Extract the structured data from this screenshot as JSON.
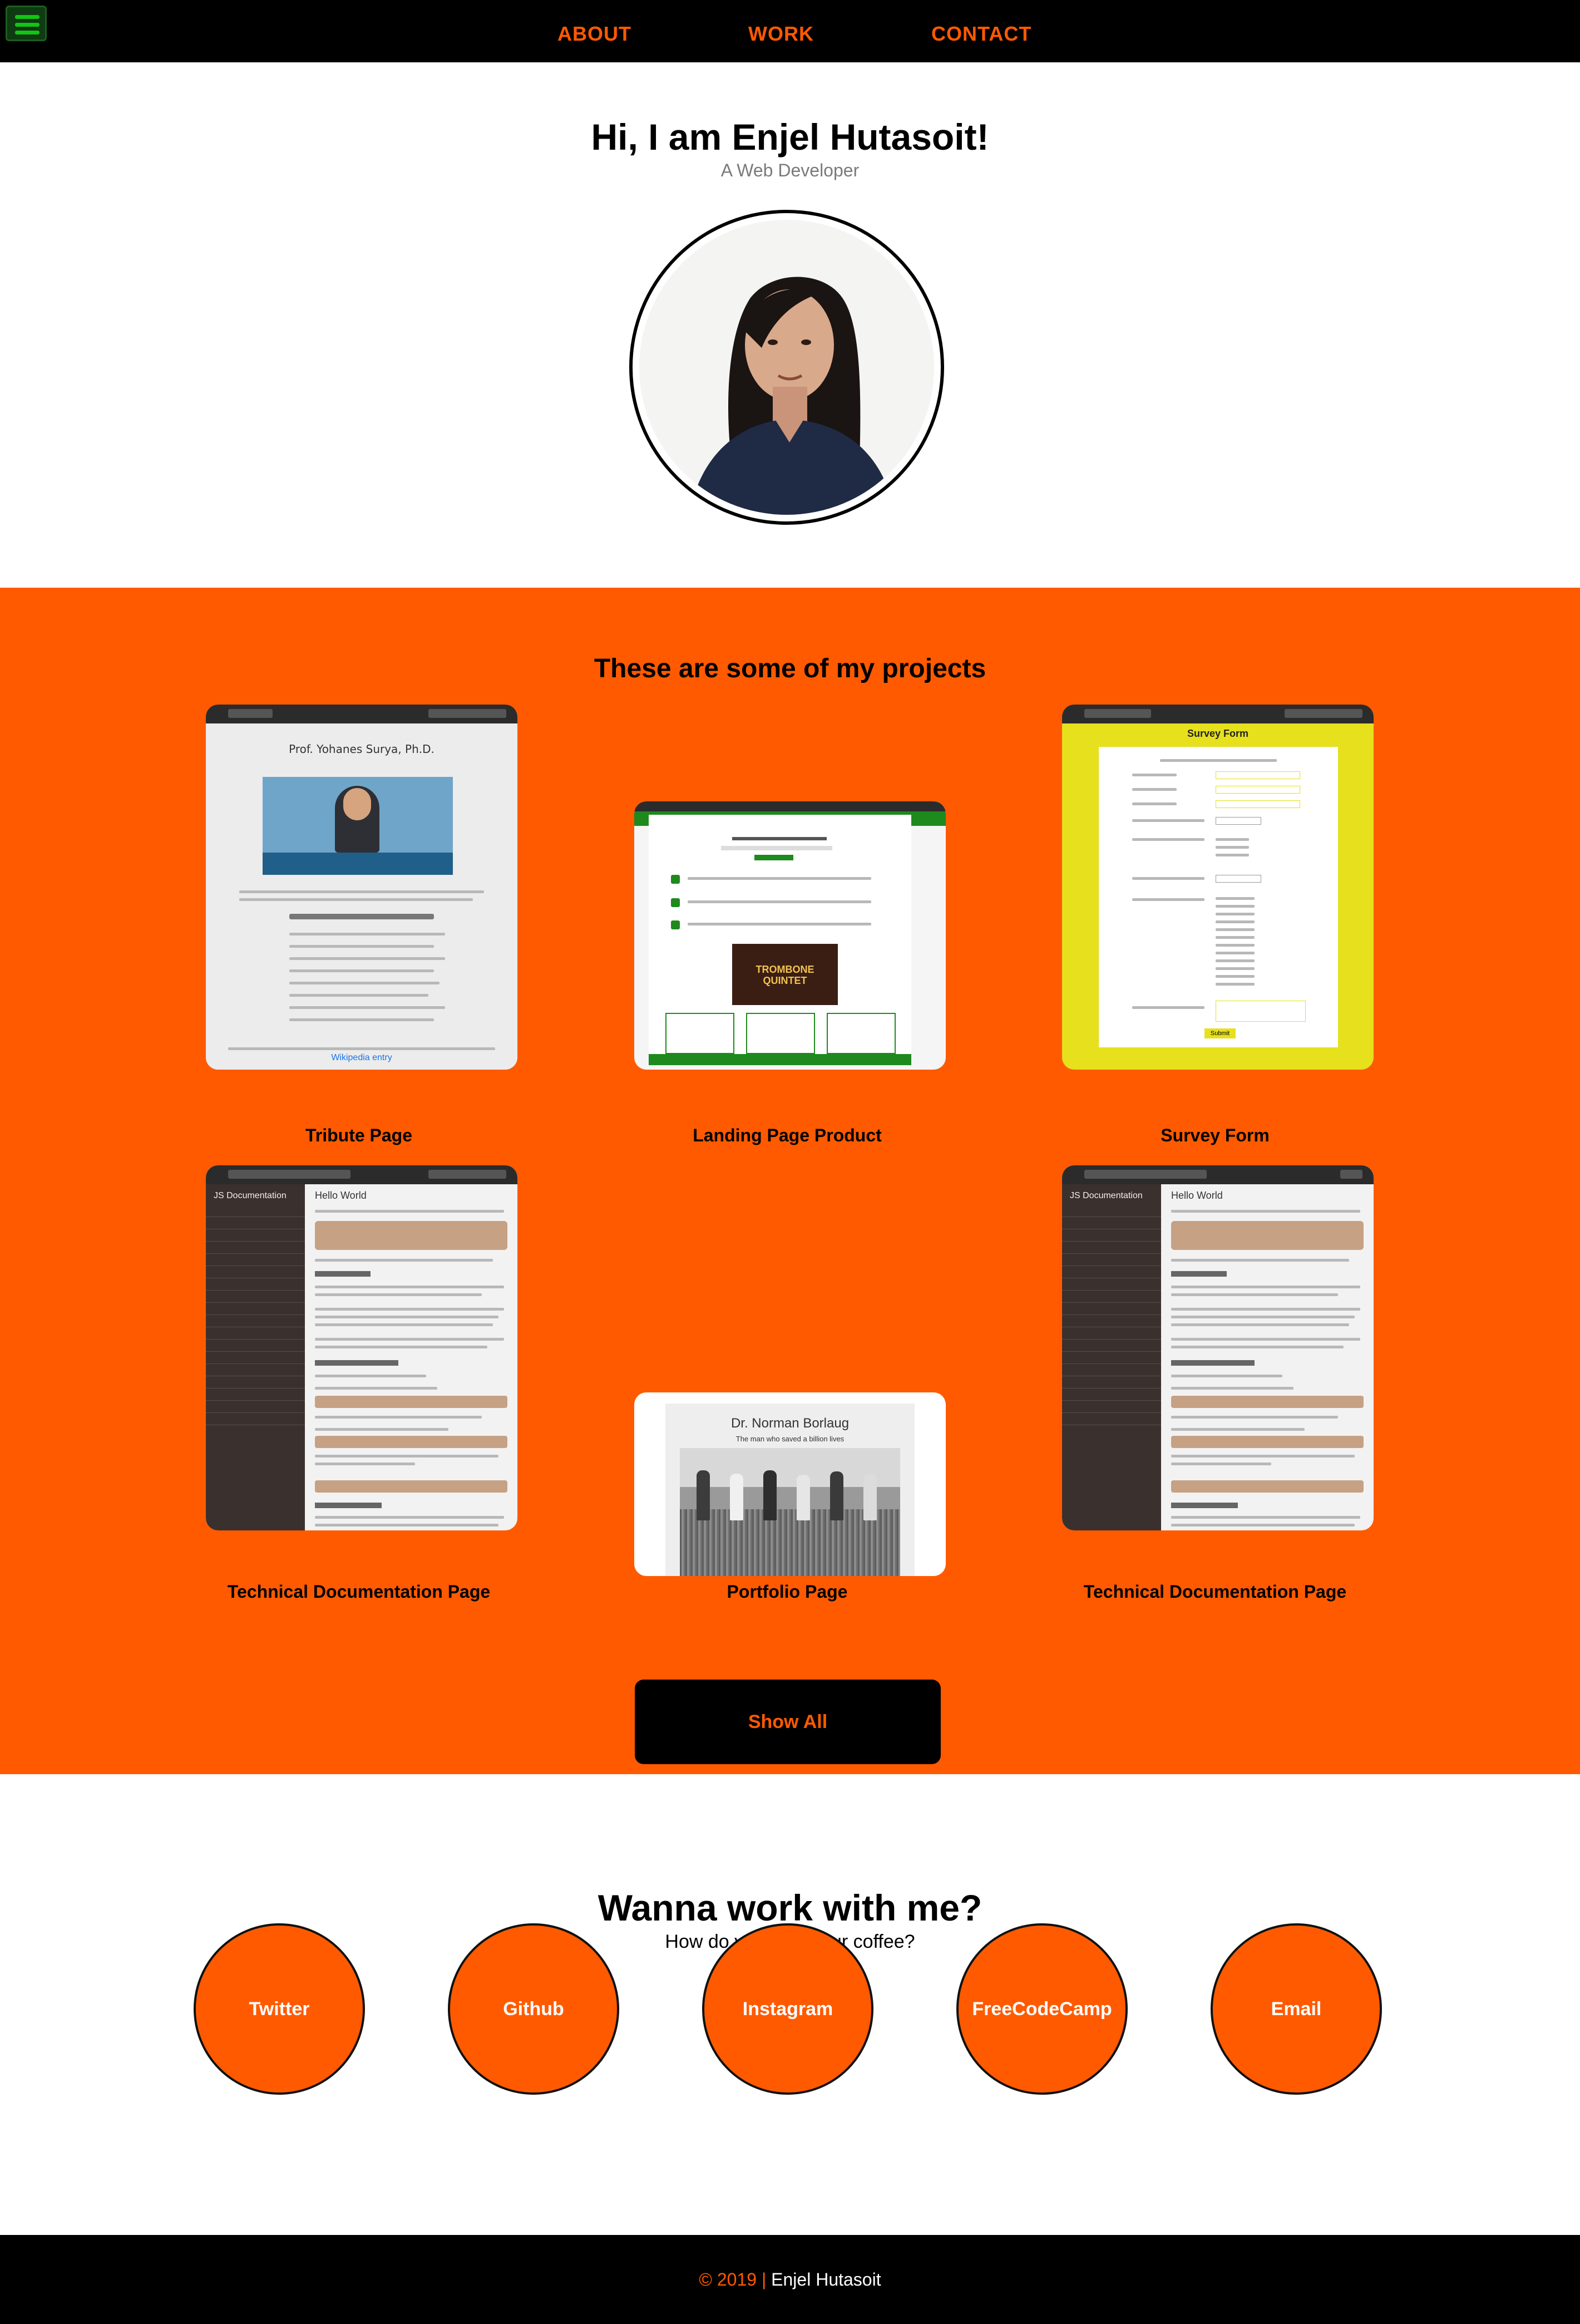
{
  "nav": {
    "links": [
      {
        "label": "ABOUT"
      },
      {
        "label": "WORK"
      },
      {
        "label": "CONTACT"
      }
    ]
  },
  "hero": {
    "title": "Hi, I am Enjel Hutasoit!",
    "subtitle": "A Web Developer"
  },
  "projects": {
    "title": "These are some of my projects",
    "items": [
      {
        "label": "Tribute Page",
        "preview_title": "Prof. Yohanes Surya, Ph.D.",
        "preview_link": "Wikipedia entry"
      },
      {
        "label": "Landing Page Product",
        "preview_title": "TROMBONE QUINTET"
      },
      {
        "label": "Survey Form",
        "preview_title": "Survey Form",
        "preview_button": "Submit"
      },
      {
        "label": "Technical Documentation Page",
        "preview_nav": "JS Documentation",
        "preview_heading": "Hello World"
      },
      {
        "label": "Portfolio Page",
        "preview_title": "Dr. Norman Borlaug",
        "preview_sub": "The man who saved a billion lives"
      },
      {
        "label": "Technical Documentation Page",
        "preview_nav": "JS Documentation",
        "preview_heading": "Hello World"
      }
    ],
    "show_all": "Show All"
  },
  "contact": {
    "title": "Wanna work with me?",
    "subtitle": "How do you take your coffee?",
    "links": [
      {
        "label": "Twitter"
      },
      {
        "label": "Github"
      },
      {
        "label": "Instagram"
      },
      {
        "label": "FreeCodeCamp"
      },
      {
        "label": "Email"
      }
    ]
  },
  "footer": {
    "copyright": "© 2019",
    "separator": "|",
    "name": "Enjel Hutasoit"
  },
  "colors": {
    "accent": "#ff5a00",
    "nav_bg": "#000000",
    "survey_bg": "#e6e01d",
    "doc_sidebar": "#3a302d"
  },
  "icons": [
    "hamburger-menu-icon"
  ]
}
